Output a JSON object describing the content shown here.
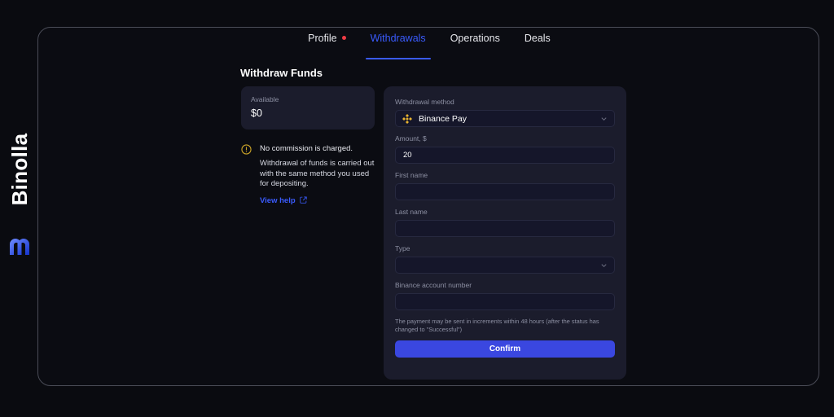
{
  "brand": {
    "name": "Binolla",
    "logo_icon": "binolla-m-mark-icon",
    "accent": "#3a5bfd"
  },
  "tabs": [
    {
      "label": "Profile",
      "active": false,
      "badge": "red-dot"
    },
    {
      "label": "Withdrawals",
      "active": true
    },
    {
      "label": "Operations",
      "active": false
    },
    {
      "label": "Deals",
      "active": false
    }
  ],
  "page": {
    "title": "Withdraw Funds"
  },
  "available": {
    "label": "Available",
    "value": "$0"
  },
  "notice": {
    "icon": "warning-circle-icon",
    "title": "No commission is charged.",
    "body": "Withdrawal of funds is carried out with the same method you used for depositing.",
    "link_label": "View help",
    "link_icon": "external-link-icon"
  },
  "form": {
    "method": {
      "label": "Withdrawal method",
      "value": "Binance Pay",
      "icon": "binance-logo-icon"
    },
    "amount": {
      "label": "Amount, $",
      "value": "20",
      "placeholder": ""
    },
    "first_name": {
      "label": "First name",
      "value": "",
      "placeholder": ""
    },
    "last_name": {
      "label": "Last name",
      "value": "",
      "placeholder": ""
    },
    "type": {
      "label": "Type",
      "value": "",
      "placeholder": ""
    },
    "account_number": {
      "label": "Binance account number",
      "value": "",
      "placeholder": ""
    },
    "note": "The payment may be sent in increments within 48 hours (after the status has changed to \"Successful\")",
    "confirm_label": "Confirm"
  },
  "colors": {
    "background": "#0a0b10",
    "panel": "#1b1c2c",
    "input": "#15162a",
    "accent_blue": "#3a5bfd",
    "button_blue": "#3a47e0",
    "warning_gold": "#c9a227",
    "danger_red": "#ef3b44"
  }
}
